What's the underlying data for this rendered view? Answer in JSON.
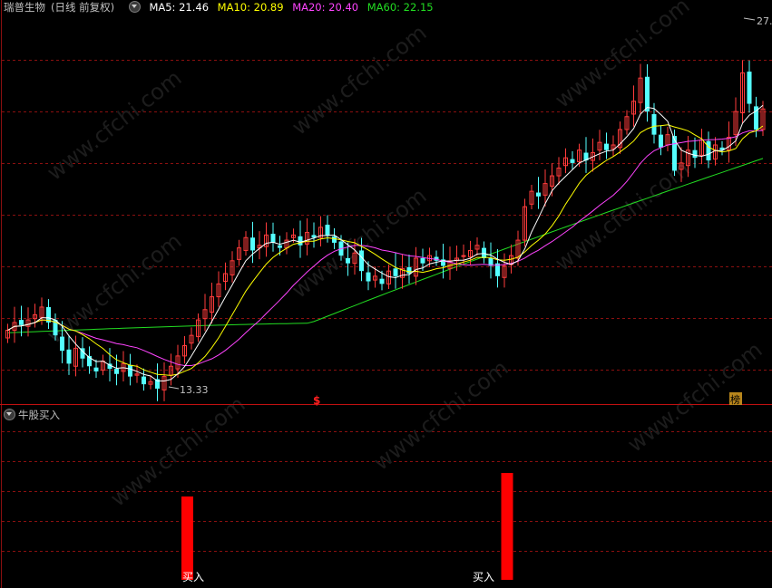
{
  "main_legend": {
    "stock_name": "瑞普生物",
    "period_label": "(日线 前复权)",
    "ma5": "MA5: 21.46",
    "ma10": "MA10: 20.89",
    "ma20": "MA20: 20.40",
    "ma60": "MA60: 22.15"
  },
  "sub_legend": {
    "indicator_name": "牛股买入"
  },
  "annotations": {
    "low_price": "13.33",
    "high_price": "27.",
    "dollar_marker": "$",
    "rank_marker": "榜",
    "buy_label": "买入"
  },
  "watermark": "www.cfchi.com",
  "colors": {
    "background": "#000000",
    "up": "#ff3b3b",
    "down": "#54ffff",
    "ma5": "#ffffff",
    "ma10": "#ffff00",
    "ma20": "#ff44ff",
    "ma60": "#22dd22",
    "grid": "#8b1010",
    "buy_bar": "#ff0000"
  },
  "chart_data": [
    {
      "type": "candlestick",
      "title": "瑞普生物(日线 前复权)",
      "series": [
        {
          "name": "MA5",
          "last": 21.46
        },
        {
          "name": "MA10",
          "last": 20.89
        },
        {
          "name": "MA20",
          "last": 20.4
        },
        {
          "name": "MA60",
          "last": 22.15
        }
      ],
      "ylim": [
        12.8,
        27.8
      ],
      "low_marker": 13.33,
      "high_marker": 27.0,
      "closes": [
        15.6,
        15.9,
        15.8,
        16.0,
        16.2,
        16.5,
        15.9,
        15.4,
        14.8,
        14.3,
        14.9,
        14.5,
        14.2,
        14.0,
        14.4,
        14.1,
        13.9,
        14.3,
        13.8,
        13.9,
        13.5,
        13.6,
        13.33,
        13.8,
        14.2,
        14.6,
        15.0,
        15.4,
        16.0,
        16.4,
        16.9,
        17.4,
        17.8,
        18.3,
        18.8,
        19.2,
        18.7,
        18.9,
        19.3,
        19.0,
        18.8,
        19.1,
        19.3,
        18.9,
        19.4,
        19.2,
        19.6,
        19.3,
        19.0,
        18.5,
        18.2,
        18.6,
        17.9,
        17.5,
        17.7,
        17.4,
        17.9,
        17.7,
        18.0,
        17.8,
        18.4,
        18.2,
        18.5,
        18.3,
        18.1,
        18.3,
        18.4,
        18.5,
        18.7,
        18.9,
        18.4,
        18.1,
        17.7,
        18.1,
        18.5,
        19.1,
        20.4,
        21.0,
        20.8,
        21.3,
        21.6,
        21.9,
        22.3,
        22.1,
        22.6,
        22.2,
        22.5,
        22.9,
        22.6,
        22.8,
        23.4,
        23.9,
        24.5,
        25.4,
        24.1,
        23.2,
        22.7,
        23.2,
        21.8,
        22.1,
        22.6,
        22.3,
        23.0,
        22.2,
        22.8,
        22.6,
        23.1,
        24.1,
        25.6,
        24.4,
        23.4,
        24.2
      ]
    },
    {
      "type": "bar",
      "title": "牛股买入",
      "series": [
        {
          "name": "买入",
          "values": [
            1.0,
            1.0
          ]
        }
      ],
      "annotations": [
        "买入",
        "买入"
      ],
      "bar_positions_x_index": [
        28,
        75
      ]
    }
  ]
}
